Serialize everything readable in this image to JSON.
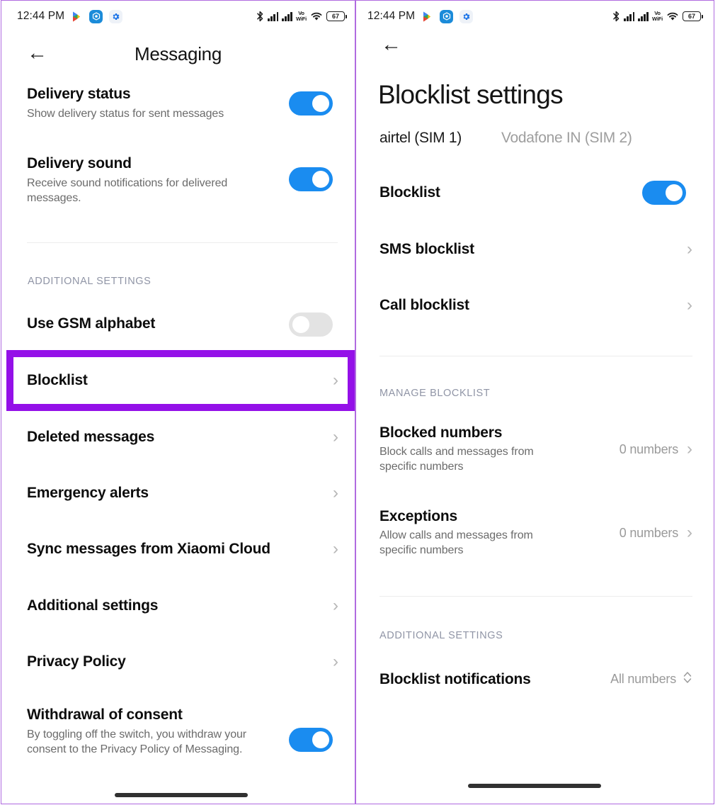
{
  "statusbar": {
    "time": "12:44 PM",
    "app_icons": [
      "play-store-icon",
      "security-app-icon",
      "settings-gear-icon"
    ],
    "right_icons": [
      "bluetooth-icon",
      "signal-sim1-icon",
      "signal-sim2-icon",
      "vowifi-icon",
      "wifi-icon",
      "battery-icon"
    ],
    "vowifi_top": "Vo",
    "vowifi_bottom": "WiFi",
    "battery_level": "67"
  },
  "left_panel": {
    "header": {
      "back": "←",
      "title": "Messaging"
    },
    "items": [
      {
        "title": "Delivery status",
        "subtitle": "Show delivery status for sent messages",
        "control": "toggle",
        "toggle_on": true
      },
      {
        "title": "Delivery sound",
        "subtitle": "Receive sound notifications for delivered messages.",
        "control": "toggle",
        "toggle_on": true
      }
    ],
    "section_label": "ADDITIONAL SETTINGS",
    "additional_items": [
      {
        "title": "Use GSM alphabet",
        "control": "toggle",
        "toggle_on": false
      },
      {
        "title": "Blocklist",
        "control": "chevron",
        "highlighted": true
      },
      {
        "title": "Deleted messages",
        "control": "chevron"
      },
      {
        "title": "Emergency alerts",
        "control": "chevron"
      },
      {
        "title": "Sync messages from Xiaomi Cloud",
        "control": "chevron"
      },
      {
        "title": "Additional settings",
        "control": "chevron"
      },
      {
        "title": "Privacy Policy",
        "control": "chevron"
      }
    ],
    "consent": {
      "title": "Withdrawal of consent",
      "subtitle": "By toggling off the switch, you withdraw your consent to the Privacy Policy of Messaging.",
      "toggle_on": true
    }
  },
  "right_panel": {
    "header": {
      "back": "←",
      "title": "Blocklist settings"
    },
    "tabs": [
      {
        "label": "airtel (SIM 1)",
        "active": true
      },
      {
        "label": "Vodafone IN (SIM 2)",
        "active": false
      }
    ],
    "items": [
      {
        "title": "Blocklist",
        "control": "toggle",
        "toggle_on": true
      },
      {
        "title": "SMS blocklist",
        "control": "chevron"
      },
      {
        "title": "Call blocklist",
        "control": "chevron"
      }
    ],
    "manage_label": "MANAGE BLOCKLIST",
    "manage_items": [
      {
        "title": "Blocked numbers",
        "subtitle": "Block calls and messages from specific numbers",
        "value": "0 numbers",
        "control": "chevron",
        "highlighted": true
      },
      {
        "title": "Exceptions",
        "subtitle": "Allow calls and messages from specific numbers",
        "value": "0 numbers",
        "control": "chevron"
      }
    ],
    "additional_label": "ADDITIONAL SETTINGS",
    "additional_items": [
      {
        "title": "Blocklist notifications",
        "value": "All numbers",
        "control": "stepper"
      }
    ]
  },
  "colors": {
    "highlight_purple": "#9410e8",
    "panel_border": "#b06be0",
    "toggle_on": "#1a8cf0",
    "toggle_off": "#e3e3e3"
  }
}
